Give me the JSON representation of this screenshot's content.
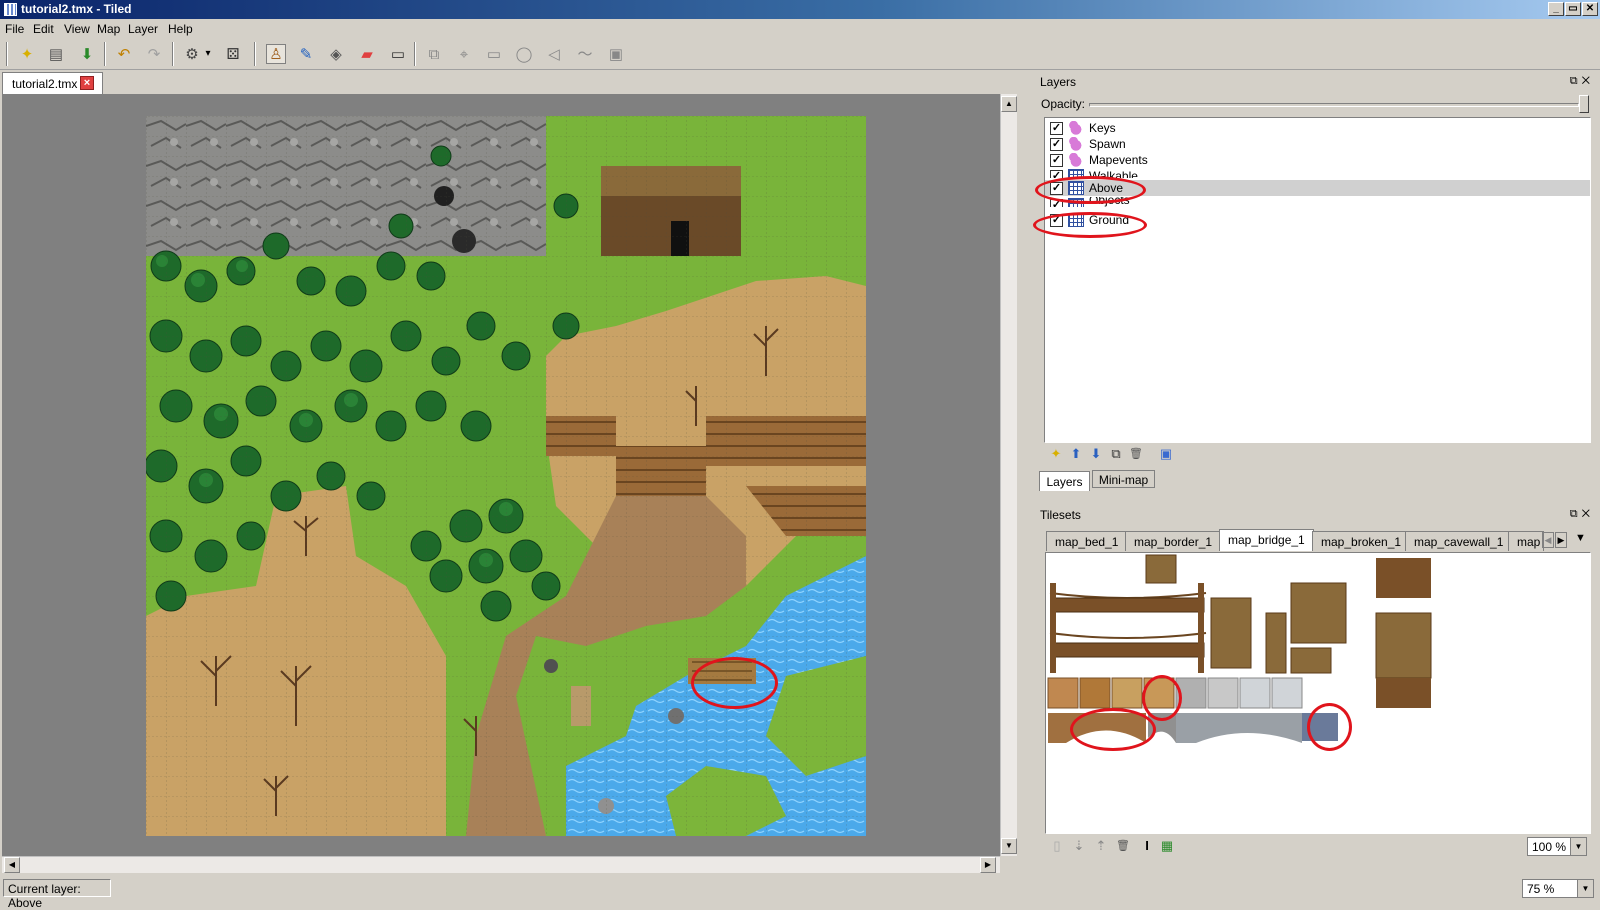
{
  "window": {
    "title": "tutorial2.tmx - Tiled",
    "minimize": "_",
    "restore": "▭",
    "close": "✕"
  },
  "menu": {
    "file": "File",
    "edit": "Edit",
    "view": "View",
    "map": "Map",
    "layer": "Layer",
    "help": "Help"
  },
  "toolbar": {
    "new_icon": "✦",
    "open_icon": "▤",
    "save_icon": "⬇",
    "undo_icon": "↶",
    "redo_icon": "↷",
    "command_icon": "⚙",
    "dropdown_icon": "▾",
    "random_icon": "⚄",
    "stamp_icon": "♙",
    "terrain_icon": "✎",
    "fill_icon": "◈",
    "eraser_icon": "▰",
    "rect_select_icon": "▭",
    "select_objects_icon": "⧉",
    "edit_polygons_icon": "⌖",
    "rect_icon": "▭",
    "ellipse_icon": "◯",
    "polygon_icon": "◁",
    "polyline_icon": "〜",
    "tile_obj_icon": "▣"
  },
  "document": {
    "tab_label": "tutorial2.tmx",
    "close_icon": "×"
  },
  "layers_panel": {
    "title": "Layers",
    "float_icon": "⧉",
    "close_icon": "✕",
    "opacity_label": "Opacity:",
    "opacity_value": 1.0,
    "layers": [
      {
        "name": "Keys",
        "type": "object",
        "visible": true
      },
      {
        "name": "Spawn",
        "type": "object",
        "visible": true
      },
      {
        "name": "Mapevents",
        "type": "object",
        "visible": true
      },
      {
        "name": "Walkable",
        "type": "tile",
        "visible": true
      },
      {
        "name": "Above",
        "type": "tile",
        "visible": true,
        "selected": true
      },
      {
        "name": "Objects",
        "type": "tile",
        "visible": true
      },
      {
        "name": "Ground",
        "type": "tile",
        "visible": true
      }
    ],
    "check_mark": "✓",
    "tools": {
      "new_icon": "✦",
      "up_icon": "⬆",
      "down_icon": "⬇",
      "duplicate_icon": "⧉",
      "delete_icon": "🗑",
      "props_icon": "▣"
    },
    "tabs": [
      "Layers",
      "Mini-map"
    ]
  },
  "tilesets_panel": {
    "title": "Tilesets",
    "float_icon": "⧉",
    "close_icon": "✕",
    "tabs": [
      "map_bed_1",
      "map_border_1",
      "map_bridge_1",
      "map_broken_1",
      "map_cavewall_1",
      "map"
    ],
    "active_tab": "map_bridge_1",
    "left_arrow": "◀",
    "right_arrow": "▶",
    "menu_arrow": "▼",
    "tools": {
      "new_icon": "▯",
      "import_icon": "⇣",
      "export_icon": "⇡",
      "delete_icon": "🗑",
      "props_icon": "I",
      "edit_icon": "▦"
    },
    "zoom": "100 %"
  },
  "status": {
    "current_layer": "Current layer: Above",
    "zoom": "75 %"
  },
  "scroll": {
    "up": "▲",
    "down": "▼",
    "left": "◀",
    "right": "▶"
  },
  "colors": {
    "highlight": "#e0141c",
    "selection": "#d0d0d0",
    "grass": "#7cb53a",
    "dirt": "#c8a064",
    "water": "#4aa8e8",
    "rock": "#8a8a88"
  }
}
